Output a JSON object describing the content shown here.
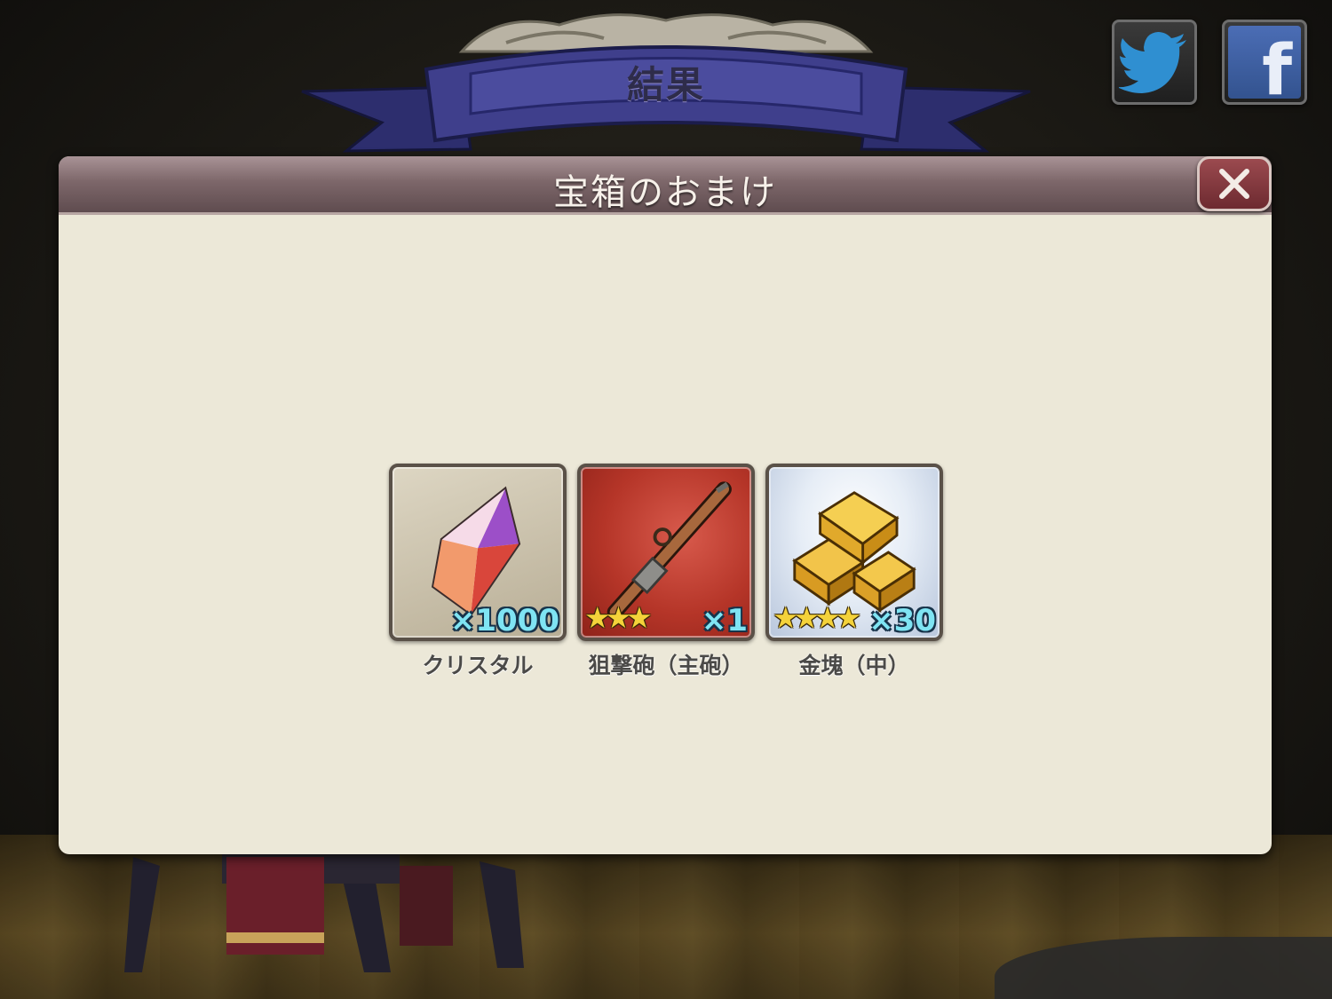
{
  "banner": {
    "title": "結果"
  },
  "social": {
    "twitter": {
      "icon": "twitter-bird-icon"
    },
    "facebook": {
      "icon": "facebook-f-icon",
      "letter": "f"
    }
  },
  "dialog": {
    "title": "宝箱のおまけ",
    "close_icon": "close-x-icon"
  },
  "rewards": [
    {
      "name": "クリスタル",
      "quantity": "×1000",
      "stars": "",
      "background": "gray",
      "icon": "crystal-icon"
    },
    {
      "name": "狙撃砲（主砲）",
      "quantity": "×1",
      "stars": "★★★",
      "background": "red",
      "icon": "sniper-rifle-icon"
    },
    {
      "name": "金塊（中）",
      "quantity": "×30",
      "stars": "★★★★",
      "background": "blue",
      "icon": "gold-bars-icon"
    }
  ],
  "colors": {
    "dialog_bg": "#ece8d8",
    "header": "#7d676a",
    "banner_ribbon": "#3f3f8c",
    "close_button": "#7d3238",
    "quantity_text": "#7fe4f3",
    "star": "#f4d23a"
  }
}
